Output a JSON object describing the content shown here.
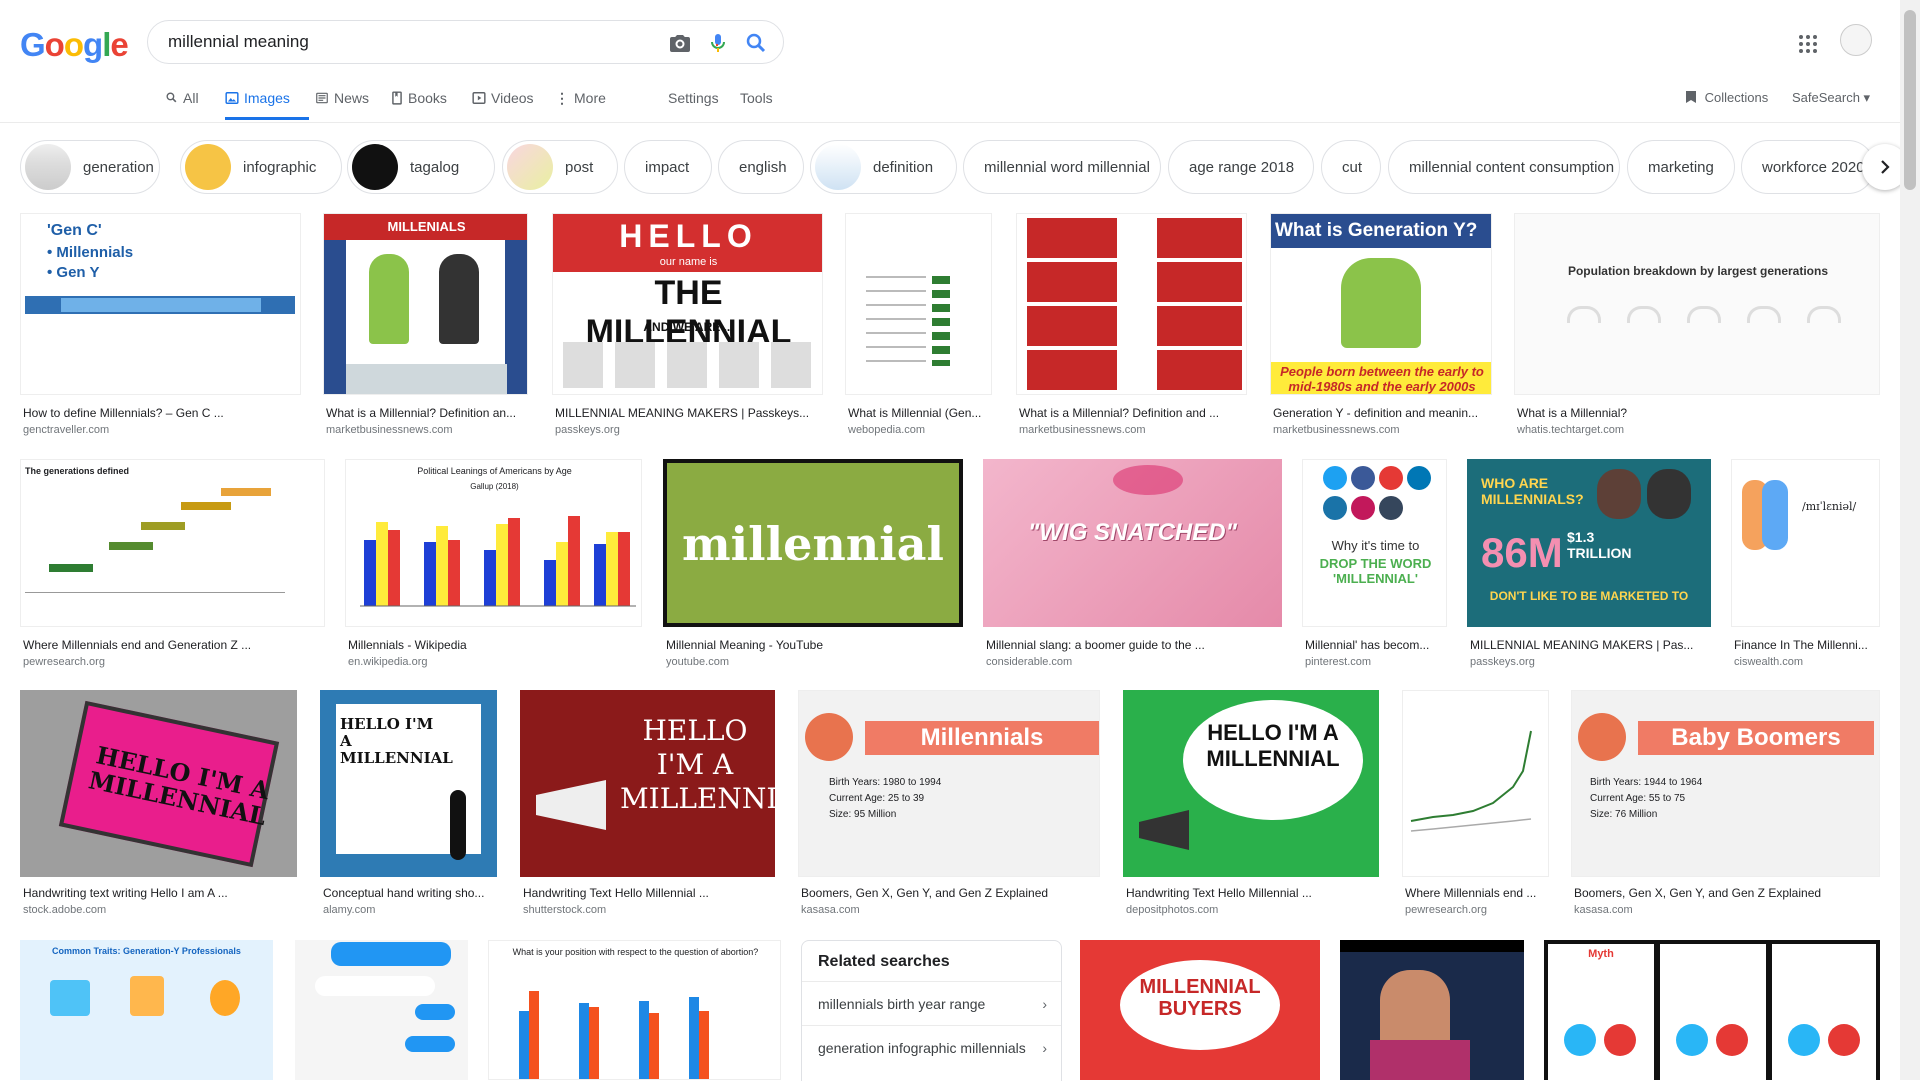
{
  "logo": [
    "G",
    "o",
    "o",
    "g",
    "l",
    "e"
  ],
  "search": {
    "value": "millennial meaning"
  },
  "tabs": {
    "all": "All",
    "images": "Images",
    "news": "News",
    "books": "Books",
    "videos": "Videos",
    "more": "More",
    "settings": "Settings",
    "tools": "Tools"
  },
  "right": {
    "collections": "Collections",
    "safesearch": "SafeSearch ▾"
  },
  "chips": [
    "generation",
    "infographic",
    "tagalog",
    "post",
    "impact",
    "english",
    "definition",
    "millennial word millennial",
    "age range 2018",
    "cut",
    "millennial content consumption",
    "marketing",
    "workforce 2020"
  ],
  "results": [
    {
      "cap": "How to define Millennials? – Gen C ...",
      "src": "genctraveller.com"
    },
    {
      "cap": "What is a Millennial? Definition an...",
      "src": "marketbusinessnews.com"
    },
    {
      "cap": "MILLENNIAL MEANING MAKERS | Passkeys...",
      "src": "passkeys.org"
    },
    {
      "cap": "What is Millennial (Gen...",
      "src": "webopedia.com"
    },
    {
      "cap": "What is a Millennial? Definition and ...",
      "src": "marketbusinessnews.com"
    },
    {
      "cap": "Generation Y - definition and meanin...",
      "src": "marketbusinessnews.com"
    },
    {
      "cap": "What is a Millennial?",
      "src": "whatis.techtarget.com"
    },
    {
      "cap": "Where Millennials end and Generation Z ...",
      "src": "pewresearch.org"
    },
    {
      "cap": "Millennials - Wikipedia",
      "src": "en.wikipedia.org"
    },
    {
      "cap": "Millennial Meaning - YouTube",
      "src": "youtube.com"
    },
    {
      "cap": "Millennial slang: a boomer guide to the ...",
      "src": "considerable.com"
    },
    {
      "cap": "Millennial' has becom...",
      "src": "pinterest.com"
    },
    {
      "cap": "MILLENNIAL MEANING MAKERS | Pas...",
      "src": "passkeys.org"
    },
    {
      "cap": "Finance In The Millenni...",
      "src": "ciswealth.com"
    },
    {
      "cap": "Handwriting text writing Hello I am A ...",
      "src": "stock.adobe.com"
    },
    {
      "cap": "Conceptual hand writing sho...",
      "src": "alamy.com"
    },
    {
      "cap": "Handwriting Text Hello Millennial ...",
      "src": "shutterstock.com"
    },
    {
      "cap": "Boomers, Gen X, Gen Y, and Gen Z Explained",
      "src": "kasasa.com"
    },
    {
      "cap": "Handwriting Text Hello Millennial ...",
      "src": "depositphotos.com"
    },
    {
      "cap": "Where Millennials end ...",
      "src": "pewresearch.org"
    },
    {
      "cap": "Boomers, Gen X, Gen Y, and Gen Z Explained",
      "src": "kasasa.com"
    }
  ],
  "imgtext": {
    "t1a": "'Gen C'",
    "t1b": "• Millennials",
    "t1c": "• Gen Y",
    "t2": "MILLENIALS",
    "t3a": "HELLO",
    "t3b": "our name is",
    "t3c": "THE MILLENNIAL",
    "t3d": "AND WE ARE ...",
    "t6a": "What is Generation Y?",
    "t6b": "People born between the early to mid-1980s and the early 2000s",
    "t7": "Population breakdown by largest generations",
    "t8": "The generations defined",
    "t9a": "Political Leanings of Americans by Age",
    "t9b": "Gallup (2018)",
    "t10": "millennial",
    "t11": "\"WIG SNATCHED\"",
    "t12a": "Why it's time to",
    "t12b": "DROP THE WORD 'MILLENNIAL'",
    "t13a": "WHO ARE MILLENNIALS?",
    "t13b": "86M",
    "t13c": "$1.3 TRILLION",
    "t13d": "DON'T LIKE TO BE MARKETED TO",
    "t14": "/mɪˈlɛniəl/",
    "t15": "HELLO I'M A MILLENNIAL",
    "t16": "HELLO I'M A MILLENNIAL",
    "t17": "HELLO I'M A MILLENNIAL",
    "t18a": "Millennials",
    "t18b": "Birth Years: 1980 to 1994",
    "t18c": "Current Age: 25 to 39",
    "t18d": "Size: 95 Million",
    "t19": "HELLO I'M A MILLENNIAL",
    "t21a": "Baby Boomers",
    "t21b": "Birth Years: 1944 to 1964",
    "t21c": "Current Age: 55 to 75",
    "t21d": "Size: 76 Million",
    "b1": "Common Traits: Generation-Y Professionals",
    "b3": "What is your position with respect to the question of abortion?",
    "b5": "MILLENNIAL BUYERS",
    "b7": "Myth"
  },
  "related": {
    "title": "Related searches",
    "items": [
      "millennials birth year range",
      "generation infographic millennials"
    ]
  }
}
